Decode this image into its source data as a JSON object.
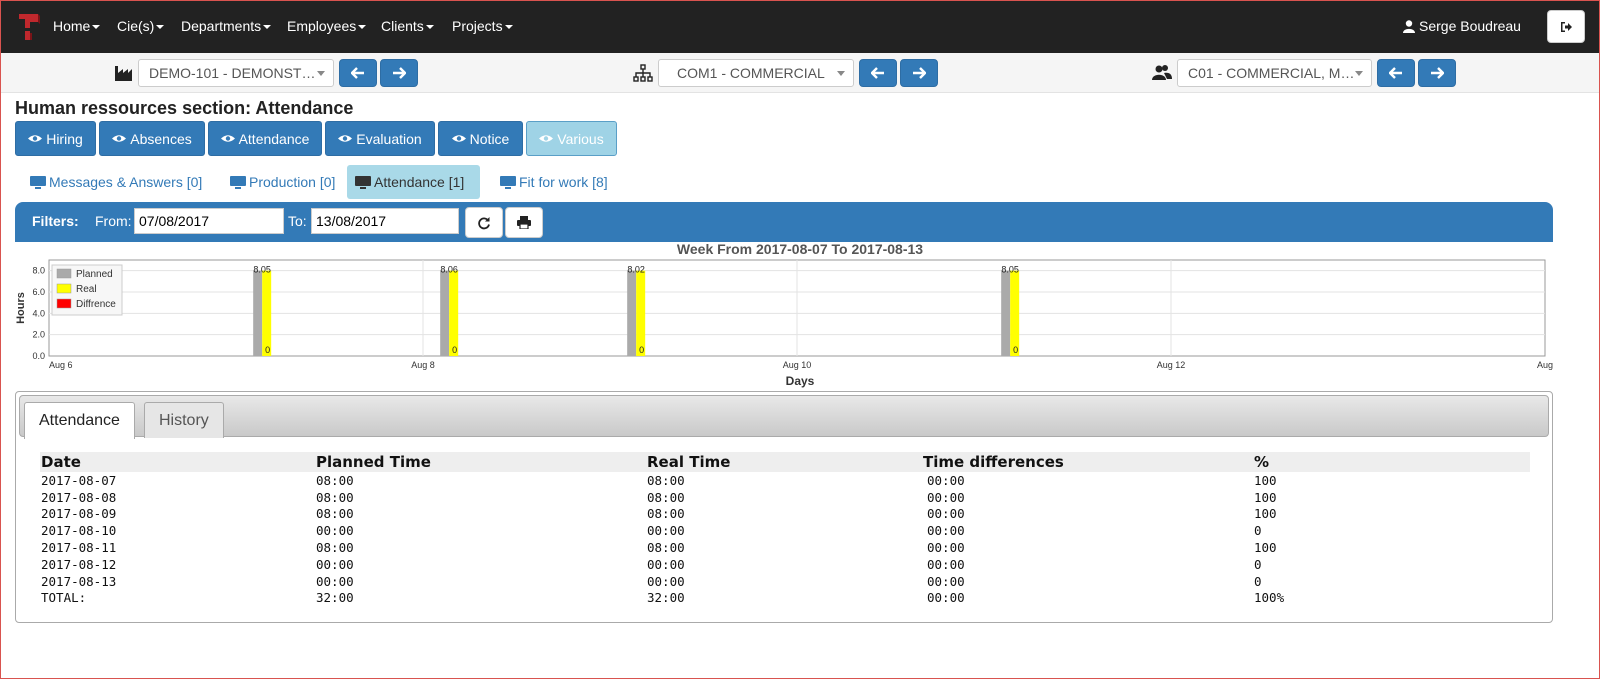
{
  "nav": {
    "items": [
      "Home",
      "Cie(s)",
      "Departments",
      "Employees",
      "Clients",
      "Projects"
    ],
    "user": "Serge Boudreau"
  },
  "selectors": {
    "company": "DEMO-101 - DEMONST…",
    "department": "COM1 - COMMERCIAL",
    "employee": "C01 - COMMERCIAL, M…"
  },
  "section_title": "Human ressources section: Attendance",
  "main_tabs": [
    "Hiring",
    "Absences",
    "Attendance",
    "Evaluation",
    "Notice",
    "Various"
  ],
  "sub_tabs": [
    "Messages & Answers [0]",
    "Production [0]",
    "Attendance [1]",
    "Fit for work [8]"
  ],
  "filters": {
    "label": "Filters",
    "from_label": "From:",
    "from_value": "07/08/2017",
    "to_label": "To:",
    "to_value": "13/08/2017"
  },
  "chart_data": {
    "type": "bar",
    "title": "Week From 2017-08-07 To 2017-08-13",
    "xlabel": "Days",
    "ylabel": "Hours",
    "ylim": [
      0,
      9
    ],
    "yticks": [
      "0.0",
      "2.0",
      "4.0",
      "6.0",
      "8.0"
    ],
    "x_tick_labels": [
      "Aug 6",
      "Aug 8",
      "Aug 10",
      "Aug 12",
      "Aug"
    ],
    "categories": [
      "2017-08-07",
      "2017-08-08",
      "2017-08-09",
      "2017-08-10",
      "2017-08-11",
      "2017-08-12",
      "2017-08-13"
    ],
    "series": [
      {
        "name": "Planned",
        "color": "#aaaaaa",
        "values": [
          8,
          8,
          8,
          0,
          8,
          0,
          0
        ]
      },
      {
        "name": "Real",
        "color": "#ffff00",
        "values": [
          8,
          8,
          8,
          0,
          8,
          0,
          0
        ]
      },
      {
        "name": "Diffrence",
        "color": "#ff0000",
        "values": [
          0,
          0,
          0,
          0,
          0,
          0,
          0
        ]
      }
    ],
    "bar_top_labels": [
      "8.05",
      "8.06",
      "8.02",
      "",
      "8.05",
      "",
      ""
    ],
    "diff_labels": [
      "0",
      "0",
      "0",
      "",
      "0",
      "",
      ""
    ],
    "legend": "top-left",
    "grid": true
  },
  "panel": {
    "tabs": [
      "Attendance",
      "History"
    ],
    "columns": [
      "Date",
      "Planned Time",
      "Real Time",
      "Time differences",
      "%"
    ],
    "rows": [
      [
        "2017-08-07",
        "08:00",
        "08:00",
        "00:00",
        "100"
      ],
      [
        "2017-08-08",
        "08:00",
        "08:00",
        "00:00",
        "100"
      ],
      [
        "2017-08-09",
        "08:00",
        "08:00",
        "00:00",
        "100"
      ],
      [
        "2017-08-10",
        "00:00",
        "00:00",
        "00:00",
        "0"
      ],
      [
        "2017-08-11",
        "08:00",
        "08:00",
        "00:00",
        "100"
      ],
      [
        "2017-08-12",
        "00:00",
        "00:00",
        "00:00",
        "0"
      ],
      [
        "2017-08-13",
        "00:00",
        "00:00",
        "00:00",
        "0"
      ],
      [
        "TOTAL:",
        "32:00",
        "32:00",
        "00:00",
        "100%"
      ]
    ]
  }
}
